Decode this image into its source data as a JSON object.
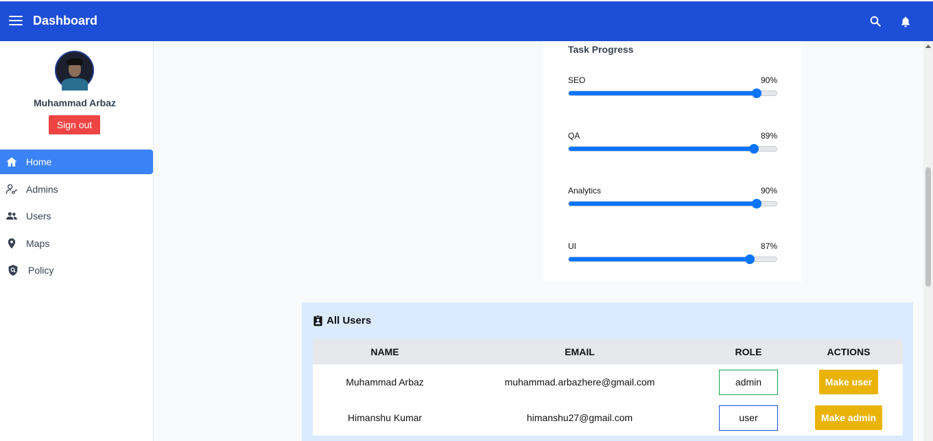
{
  "header": {
    "title": "Dashboard",
    "menu_icon": "menu-icon",
    "search_icon": "search-icon",
    "bell_icon": "bell-icon"
  },
  "profile": {
    "name": "Muhammad Arbaz",
    "signout_label": "Sign out"
  },
  "sidebar": {
    "items": [
      {
        "label": "Home",
        "icon": "home-icon",
        "active": true
      },
      {
        "label": "Admins",
        "icon": "admin-key-icon",
        "active": false
      },
      {
        "label": "Users",
        "icon": "users-icon",
        "active": false
      },
      {
        "label": "Maps",
        "icon": "map-pin-icon",
        "active": false
      },
      {
        "label": "Policy",
        "icon": "shield-icon",
        "active": false
      }
    ]
  },
  "task_progress": {
    "title": "Task Progress",
    "tasks": [
      {
        "name": "SEO",
        "percent_label": "90%",
        "value": 90
      },
      {
        "name": "QA",
        "percent_label": "89%",
        "value": 89
      },
      {
        "name": "Analytics",
        "percent_label": "90%",
        "value": 90
      },
      {
        "name": "UI",
        "percent_label": "87%",
        "value": 87
      }
    ]
  },
  "users_table": {
    "title": "All Users",
    "headers": {
      "name": "NAME",
      "email": "EMAIL",
      "role": "ROLE",
      "actions": "ACTIONS"
    },
    "rows": [
      {
        "name": "Muhammad Arbaz",
        "email": "muhammad.arbazhere@gmail.com",
        "role": "admin",
        "action": "Make user"
      },
      {
        "name": "Himanshu Kumar",
        "email": "himanshu27@gmail.com",
        "role": "user",
        "action": "Make admin"
      }
    ]
  },
  "colors": {
    "topbar": "#1d4ed8",
    "active_nav": "#3b82f6",
    "signout": "#ef4444",
    "progress": "#0b74ff",
    "action_button": "#eab308",
    "users_card_bg": "#dbeafe"
  }
}
